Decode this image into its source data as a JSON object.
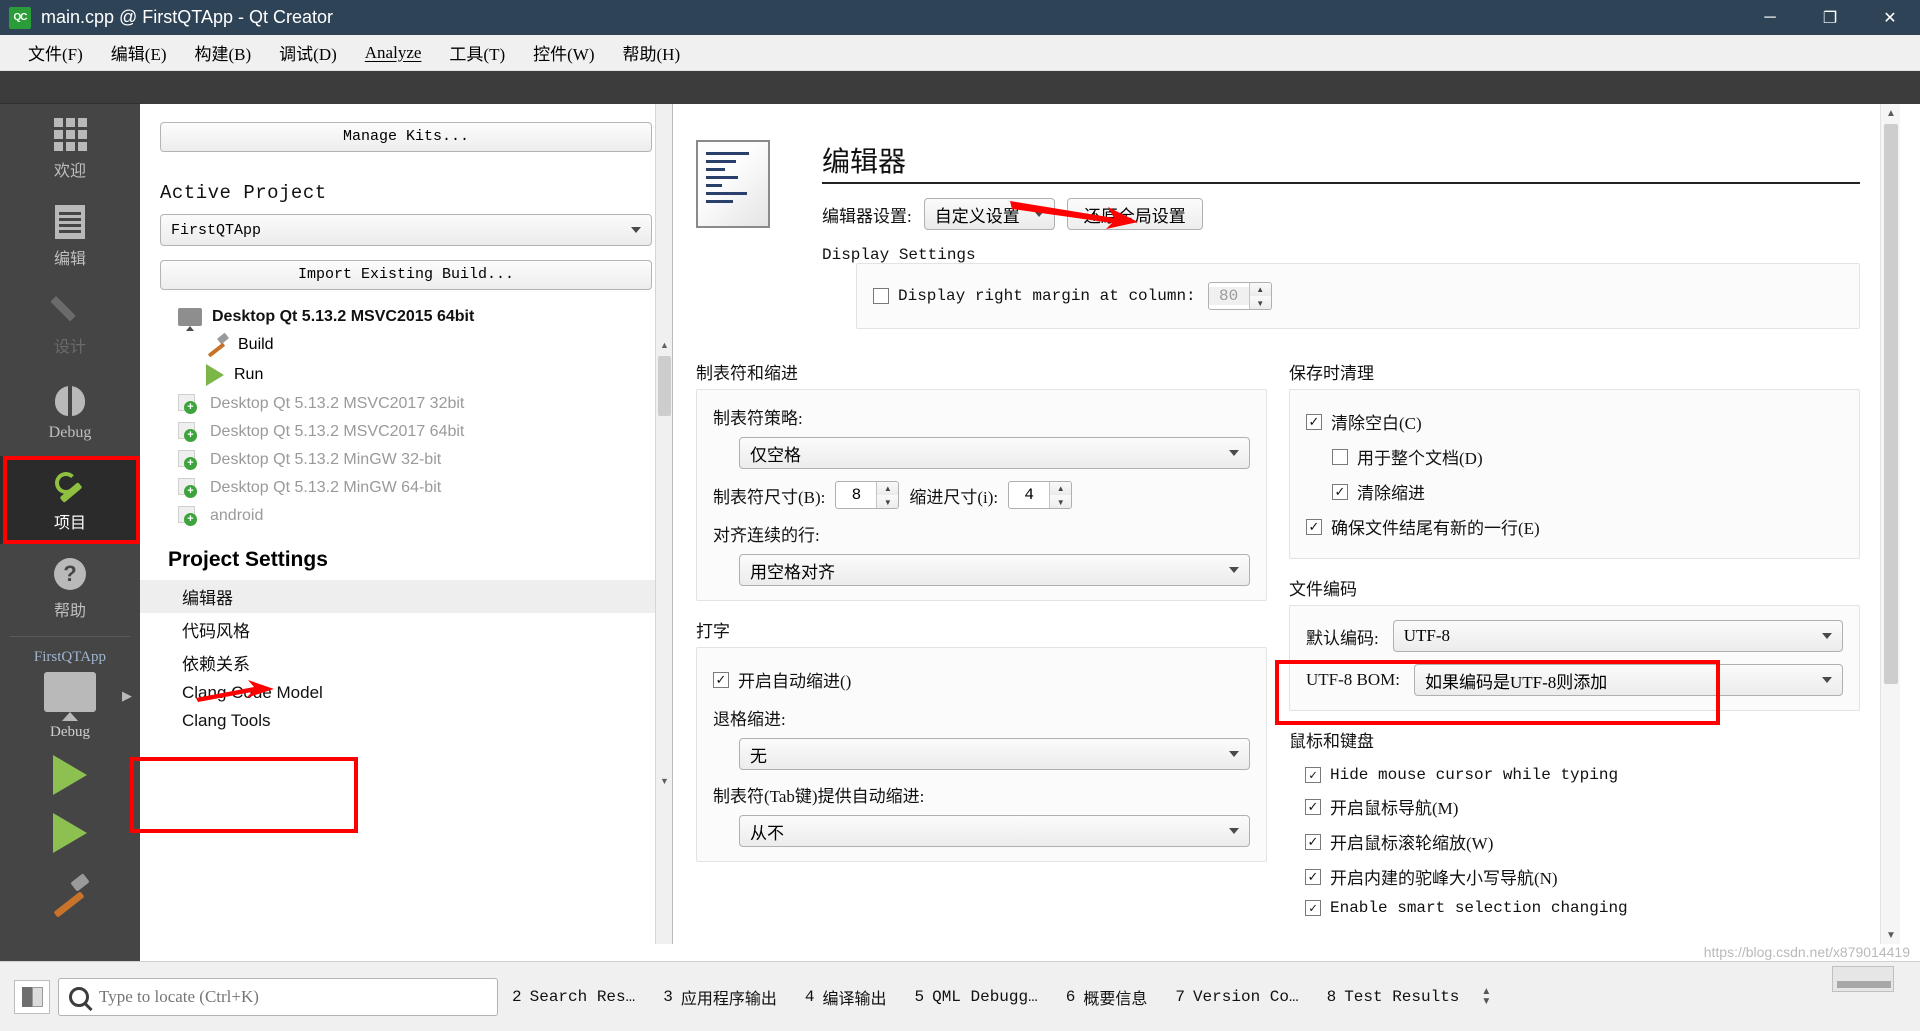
{
  "titlebar": {
    "logo": "QC",
    "title": "main.cpp @ FirstQTApp - Qt Creator",
    "minimize": "─",
    "maximize": "❐",
    "close": "✕"
  },
  "menubar": {
    "items": [
      {
        "label": "文件(F)"
      },
      {
        "label": "编辑(E)"
      },
      {
        "label": "构建(B)"
      },
      {
        "label": "调试(D)"
      },
      {
        "label": "Analyze"
      },
      {
        "label": "工具(T)"
      },
      {
        "label": "控件(W)"
      },
      {
        "label": "帮助(H)"
      }
    ]
  },
  "modebar": {
    "modes": [
      {
        "label": "欢迎",
        "icon": "grid-icon",
        "state": "normal"
      },
      {
        "label": "编辑",
        "icon": "document-icon",
        "state": "normal"
      },
      {
        "label": "设计",
        "icon": "pencil-icon",
        "state": "disabled"
      },
      {
        "label": "Debug",
        "icon": "bug-icon",
        "state": "normal"
      },
      {
        "label": "项目",
        "icon": "wrench-icon",
        "state": "active"
      },
      {
        "label": "帮助",
        "icon": "question-icon",
        "state": "normal"
      }
    ],
    "kit": {
      "project_name": "FirstQTApp",
      "build_config": "Debug",
      "expand_arrow": "▶"
    }
  },
  "leftpane": {
    "manage_kits_button": "Manage Kits...",
    "active_project_header": "Active Project",
    "active_project_value": "FirstQTApp",
    "import_build_button": "Import Existing Build...",
    "kits": [
      {
        "label": "Desktop Qt 5.13.2 MSVC2015 64bit",
        "type": "active-kit"
      },
      {
        "label": "Build",
        "type": "build"
      },
      {
        "label": "Run",
        "type": "run"
      },
      {
        "label": "Desktop Qt 5.13.2 MSVC2017 32bit",
        "type": "inactive-kit"
      },
      {
        "label": "Desktop Qt 5.13.2 MSVC2017 64bit",
        "type": "inactive-kit"
      },
      {
        "label": "Desktop Qt 5.13.2 MinGW 32-bit",
        "type": "inactive-kit"
      },
      {
        "label": "Desktop Qt 5.13.2 MinGW 64-bit",
        "type": "inactive-kit"
      },
      {
        "label": "android",
        "type": "inactive-kit"
      }
    ],
    "project_settings_title": "Project Settings",
    "project_settings_items": [
      {
        "label": "编辑器",
        "selected": true
      },
      {
        "label": "代码风格",
        "selected": false
      },
      {
        "label": "依赖关系",
        "selected": false
      },
      {
        "label": "Clang Code Model",
        "selected": false
      },
      {
        "label": "Clang Tools",
        "selected": false
      }
    ]
  },
  "editor_page": {
    "page_title": "编辑器",
    "settings_label": "编辑器设置:",
    "settings_value": "自定义设置",
    "restore_button": "还原全局设置",
    "display_settings_label": "Display Settings",
    "display_right_margin_label": "Display right margin at column:",
    "display_right_margin_checked": false,
    "right_margin_value": "80",
    "tabs_group_label": "制表符和缩进",
    "tab_policy_label": "制表符策略:",
    "tab_policy_value": "仅空格",
    "tab_size_label": "制表符尺寸(B):",
    "tab_size_value": "8",
    "indent_size_label": "缩进尺寸(i):",
    "indent_size_value": "4",
    "align_continuation_label": "对齐连续的行:",
    "align_continuation_value": "用空格对齐",
    "typing_group_label": "打字",
    "auto_indent_label": "开启自动缩进()",
    "auto_indent_checked": true,
    "backspace_indent_label": "退格缩进:",
    "backspace_indent_value": "无",
    "tab_key_indent_label": "制表符(Tab键)提供自动缩进:",
    "tab_key_indent_value": "从不",
    "cleanup_group_label": "保存时清理",
    "cleanup_items": [
      {
        "label": "清除空白(C)",
        "checked": true,
        "indent": false
      },
      {
        "label": "用于整个文档(D)",
        "checked": false,
        "indent": true
      },
      {
        "label": "清除缩进",
        "checked": true,
        "indent": true
      },
      {
        "label": "确保文件结尾有新的一行(E)",
        "checked": true,
        "indent": false
      }
    ],
    "encoding_group_label": "文件编码",
    "default_encoding_label": "默认编码:",
    "default_encoding_value": "UTF-8",
    "utf8_bom_label": "UTF-8 BOM:",
    "utf8_bom_value": "如果编码是UTF-8则添加",
    "mouse_keyboard_group_label": "鼠标和键盘",
    "mouse_keyboard_items": [
      {
        "label": "Hide mouse cursor while typing",
        "checked": true,
        "mono": true
      },
      {
        "label": "开启鼠标导航(M)",
        "checked": true,
        "mono": false
      },
      {
        "label": "开启鼠标滚轮缩放(W)",
        "checked": true,
        "mono": false
      },
      {
        "label": "开启内建的驼峰大小写导航(N)",
        "checked": true,
        "mono": false
      },
      {
        "label": "Enable smart selection changing",
        "checked": true,
        "mono": true
      }
    ]
  },
  "bottombar": {
    "locator_placeholder": "Type to locate (Ctrl+K)",
    "panes": [
      {
        "num": "2",
        "label": "Search Res…"
      },
      {
        "num": "3",
        "label": "应用程序输出"
      },
      {
        "num": "4",
        "label": "编译输出"
      },
      {
        "num": "5",
        "label": "QML Debugg…"
      },
      {
        "num": "6",
        "label": "概要信息"
      },
      {
        "num": "7",
        "label": "Version Co…"
      },
      {
        "num": "8",
        "label": "Test Results"
      }
    ]
  },
  "watermark": "https://blog.csdn.net/x879014419",
  "colors": {
    "titlebar_bg": "#2e4356",
    "mode_bar_bg": "#454545",
    "accent_green": "#8cc152",
    "annotation_red": "#ff0000"
  }
}
